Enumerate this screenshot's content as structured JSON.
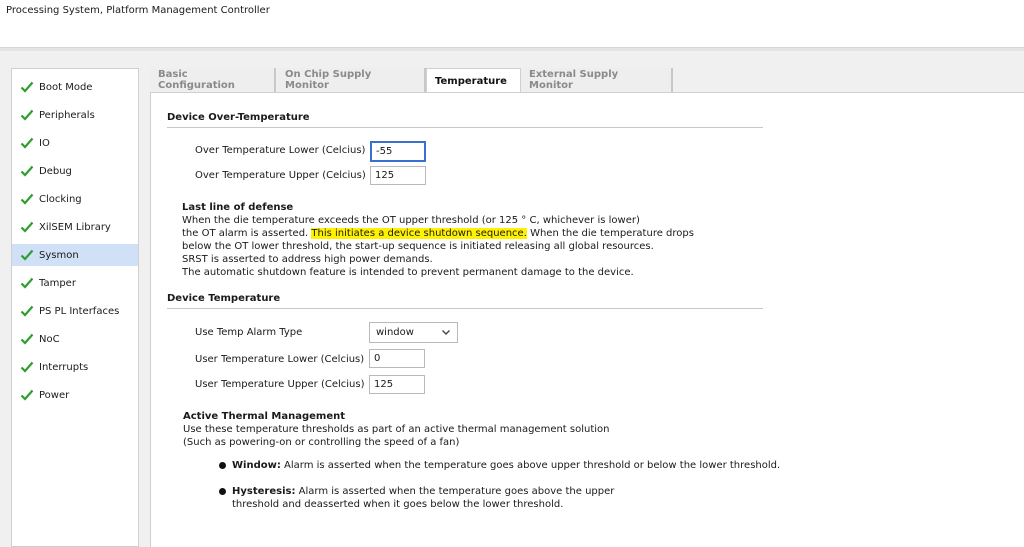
{
  "window": {
    "title": "Processing System, Platform Management Controller"
  },
  "colors": {
    "check": "#2e9e2e",
    "selected": "#cfe0f7",
    "highlight": "#fff200",
    "focus": "#3a6fd0"
  },
  "sidebar": {
    "items": [
      {
        "label": "Boot Mode"
      },
      {
        "label": "Peripherals"
      },
      {
        "label": "IO"
      },
      {
        "label": "Debug"
      },
      {
        "label": "Clocking"
      },
      {
        "label": "XilSEM Library"
      },
      {
        "label": "Sysmon"
      },
      {
        "label": "Tamper"
      },
      {
        "label": "PS PL Interfaces"
      },
      {
        "label": "NoC"
      },
      {
        "label": "Interrupts"
      },
      {
        "label": "Power"
      }
    ],
    "selected": "Sysmon"
  },
  "tabs": [
    {
      "label": "Basic Configuration"
    },
    {
      "label": "On Chip Supply Monitor"
    },
    {
      "label": "Temperature"
    },
    {
      "label": "External Supply Monitor"
    }
  ],
  "over_temp": {
    "title": "Device Over-Temperature",
    "lower_label": "Over Temperature Lower (Celcius)",
    "lower_value": "-55",
    "upper_label": "Over Temperature Upper (Celcius)",
    "upper_value": "125"
  },
  "defense": {
    "title": "Last line of defense",
    "line1": "When the die temperature exceeds the OT upper threshold (or 125 ° C, whichever is lower)",
    "line2_pre": "the OT alarm is asserted.",
    "line2_hl": "This initiates a device shutdown sequence.",
    "line2_post": "When the die temperature drops",
    "line3": "below the OT lower threshold, the start-up sequence is initiated releasing all global resources.",
    "line4": "SRST is asserted to address high power demands.",
    "line5": "The automatic shutdown feature is intended to prevent permanent damage to the device."
  },
  "device_temp": {
    "title": "Device Temperature",
    "alarm_label": "Use Temp Alarm Type",
    "alarm_value": "window",
    "lower_label": "User Temperature Lower (Celcius)",
    "lower_value": "0",
    "upper_label": "User Temperature Upper (Celcius)",
    "upper_value": "125"
  },
  "thermal": {
    "title": "Active Thermal Management",
    "line1": "Use these temperature thresholds as part of an active thermal management solution",
    "line2": "(Such as powering-on or controlling the speed of a fan)",
    "window_term": "Window:",
    "window_desc": "Alarm is asserted when the temperature goes above upper threshold or below the lower threshold.",
    "hyst_term": "Hysteresis:",
    "hyst_desc1": "Alarm is asserted when the temperature goes above the upper",
    "hyst_desc2": "threshold and deasserted when it goes below the lower threshold."
  }
}
